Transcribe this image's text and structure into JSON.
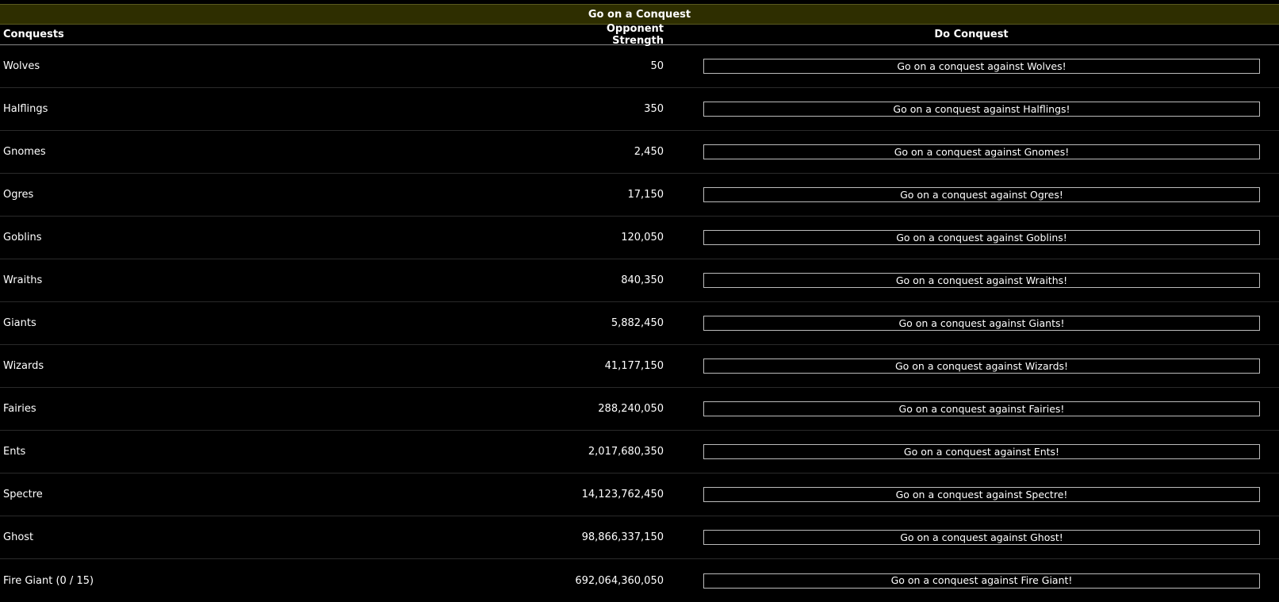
{
  "title": "Go on a Conquest",
  "headers": {
    "name": "Conquests",
    "strength": "Opponent Strength",
    "action": "Do Conquest"
  },
  "rows": [
    {
      "name": "Wolves",
      "strength": "50",
      "button": "Go on a conquest against Wolves!"
    },
    {
      "name": "Halflings",
      "strength": "350",
      "button": "Go on a conquest against Halflings!"
    },
    {
      "name": "Gnomes",
      "strength": "2,450",
      "button": "Go on a conquest against Gnomes!"
    },
    {
      "name": "Ogres",
      "strength": "17,150",
      "button": "Go on a conquest against Ogres!"
    },
    {
      "name": "Goblins",
      "strength": "120,050",
      "button": "Go on a conquest against Goblins!"
    },
    {
      "name": "Wraiths",
      "strength": "840,350",
      "button": "Go on a conquest against Wraiths!"
    },
    {
      "name": "Giants",
      "strength": "5,882,450",
      "button": "Go on a conquest against Giants!"
    },
    {
      "name": "Wizards",
      "strength": "41,177,150",
      "button": "Go on a conquest against Wizards!"
    },
    {
      "name": "Fairies",
      "strength": "288,240,050",
      "button": "Go on a conquest against Fairies!"
    },
    {
      "name": "Ents",
      "strength": "2,017,680,350",
      "button": "Go on a conquest against Ents!"
    },
    {
      "name": "Spectre",
      "strength": "14,123,762,450",
      "button": "Go on a conquest against Spectre!"
    },
    {
      "name": "Ghost",
      "strength": "98,866,337,150",
      "button": "Go on a conquest against Ghost!"
    },
    {
      "name": "Fire Giant (0 / 15)",
      "strength": "692,064,360,050",
      "button": "Go on a conquest against Fire Giant!"
    }
  ],
  "colors": {
    "background": "#000000",
    "title_bar": "#2e2e00",
    "text": "#ffffff",
    "button_border": "#bbbbbb"
  }
}
